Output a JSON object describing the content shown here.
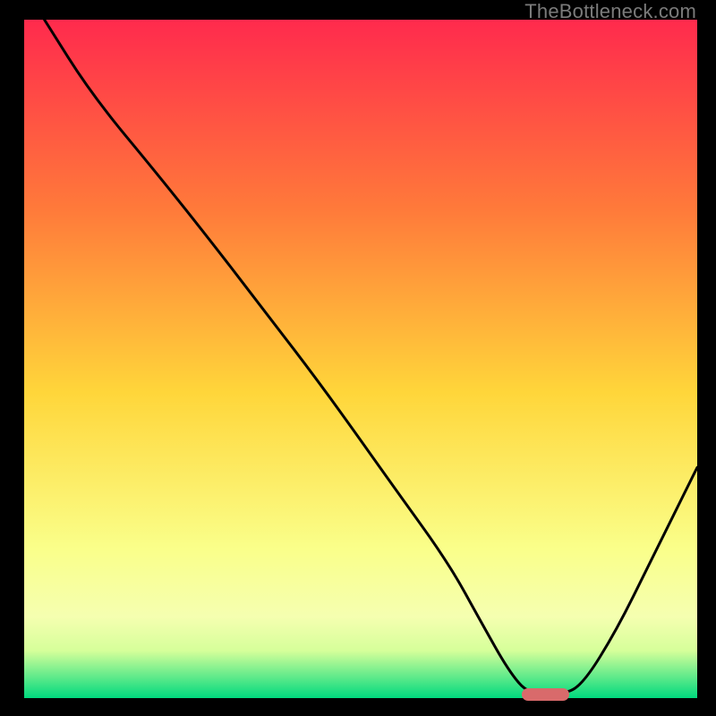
{
  "watermark": "TheBottleneck.com",
  "colors": {
    "gradient_top": "#ff2a4d",
    "gradient_mid1": "#ff7a3a",
    "gradient_mid2": "#ffd63a",
    "gradient_mid3": "#faff8a",
    "gradient_mid4": "#d6ff9a",
    "gradient_bottom": "#00d97e",
    "curve": "#000000",
    "marker": "#d96a6b",
    "frame": "#000000"
  },
  "chart_data": {
    "type": "line",
    "title": "",
    "xlabel": "",
    "ylabel": "",
    "xlim": [
      0,
      100
    ],
    "ylim": [
      0,
      100
    ],
    "series": [
      {
        "name": "bottleneck-curve",
        "x": [
          3,
          10,
          20,
          28,
          35,
          45,
          55,
          63,
          68,
          72,
          75,
          80,
          83,
          88,
          93,
          100
        ],
        "y": [
          100,
          89,
          77,
          67,
          58,
          45,
          31,
          20,
          11,
          4,
          0.5,
          0.5,
          2,
          10,
          20,
          34
        ]
      }
    ],
    "marker": {
      "x_start": 74,
      "x_end": 81,
      "y": 0.5
    },
    "gradient_stops_pct": [
      0,
      28,
      55,
      78,
      88,
      93,
      100
    ]
  }
}
